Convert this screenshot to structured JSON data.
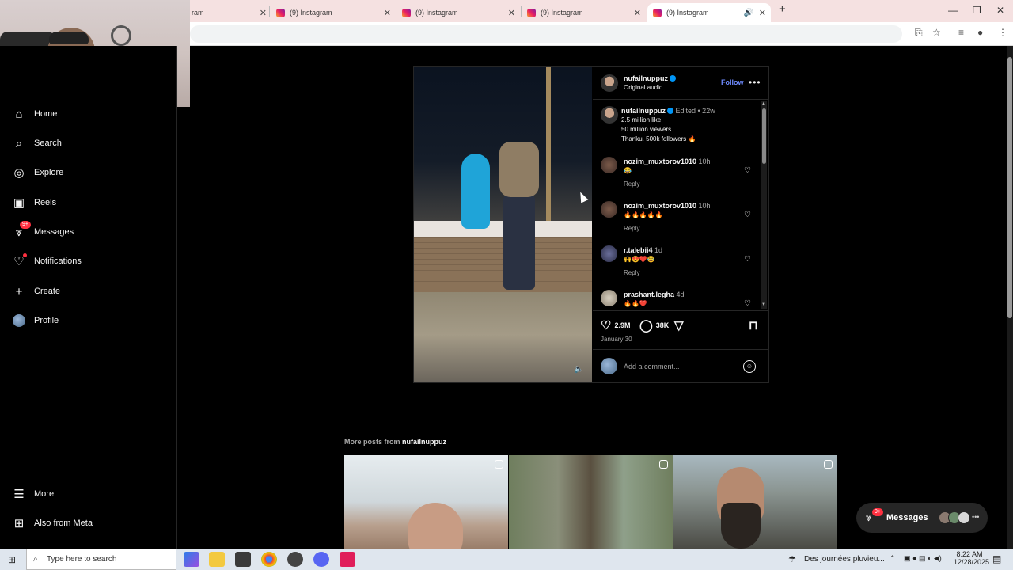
{
  "browser": {
    "tabs": [
      {
        "title": "ram"
      },
      {
        "title": "(9) Instagram"
      },
      {
        "title": "(9) Instagram"
      },
      {
        "title": "(9) Instagram"
      },
      {
        "title": "(9) Instagram"
      }
    ],
    "new_tab_label": "+"
  },
  "sidebar": {
    "items": [
      {
        "label": "Home",
        "icon": "home-icon"
      },
      {
        "label": "Search",
        "icon": "search-icon"
      },
      {
        "label": "Explore",
        "icon": "compass-icon"
      },
      {
        "label": "Reels",
        "icon": "reels-icon"
      },
      {
        "label": "Messages",
        "icon": "messenger-icon",
        "badge": "9+"
      },
      {
        "label": "Notifications",
        "icon": "heart-icon"
      },
      {
        "label": "Create",
        "icon": "plus-icon"
      },
      {
        "label": "Profile",
        "icon": "avatar"
      }
    ],
    "bottom": [
      {
        "label": "More",
        "icon": "menu-icon"
      },
      {
        "label": "Also from Meta",
        "icon": "meta-grid-icon"
      }
    ]
  },
  "post": {
    "author": "nufailnuppuz",
    "audio": "Original audio",
    "follow_label": "Follow",
    "caption": {
      "author": "nufailnuppuz",
      "meta": "Edited • 22w",
      "lines": [
        "2.5 million like",
        "50 million viewers",
        "Thanku. 500k followers 🔥"
      ]
    },
    "comments": [
      {
        "user": "nozim_muxtorov1010",
        "time": "10h",
        "text": "😂",
        "reply": "Reply"
      },
      {
        "user": "nozim_muxtorov1010",
        "time": "10h",
        "text": "🔥🔥🔥🔥🔥",
        "reply": "Reply"
      },
      {
        "user": "r.talebii4",
        "time": "1d",
        "text": "🙌😍❤️😂",
        "reply": "Reply"
      },
      {
        "user": "prashant.legha",
        "time": "4d",
        "text": "🔥🔥❤️"
      }
    ],
    "likes": "2.9M",
    "comments_count": "38K",
    "date": "January 30",
    "comment_placeholder": "Add a comment..."
  },
  "more_posts": {
    "label": "More posts from",
    "author": "nufailnuppuz"
  },
  "messages_pill": {
    "label": "Messages",
    "badge": "9+"
  },
  "taskbar": {
    "search_placeholder": "Type here to search",
    "weather": "Des journées pluvieu...",
    "time": "8:22 AM",
    "date": "12/28/2025"
  },
  "colors": {
    "accent": "#0095f6",
    "follow": "#6e8bff",
    "badge": "#ff3040",
    "background": "#000000"
  }
}
